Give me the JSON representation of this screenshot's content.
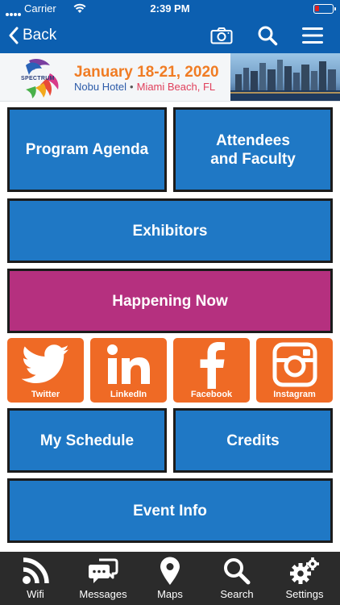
{
  "status": {
    "carrier": "Carrier",
    "time": "2:39 PM"
  },
  "nav": {
    "back_label": "Back"
  },
  "banner": {
    "logo_text": "SPECTRUM",
    "dates": "January 18-21, 2020",
    "venue": "Nobu Hotel",
    "separator": "•",
    "city": "Miami Beach, FL"
  },
  "tiles": {
    "program_agenda": "Program Agenda",
    "attendees_line1": "Attendees",
    "attendees_line2": "and Faculty",
    "exhibitors": "Exhibitors",
    "happening_now": "Happening Now",
    "my_schedule": "My Schedule",
    "credits": "Credits",
    "event_info": "Event Info"
  },
  "social": [
    {
      "label": "Twitter",
      "icon": "twitter-icon"
    },
    {
      "label": "LinkedIn",
      "icon": "linkedin-icon"
    },
    {
      "label": "Facebook",
      "icon": "facebook-icon"
    },
    {
      "label": "Instagram",
      "icon": "instagram-icon"
    }
  ],
  "tabs": [
    {
      "label": "Wifi",
      "icon": "wifi-icon"
    },
    {
      "label": "Messages",
      "icon": "messages-icon"
    },
    {
      "label": "Maps",
      "icon": "map-pin-icon"
    },
    {
      "label": "Search",
      "icon": "search-icon"
    },
    {
      "label": "Settings",
      "icon": "gears-icon"
    }
  ],
  "colors": {
    "header_blue": "#0c5fb0",
    "tile_blue": "#1f78c5",
    "magenta": "#b5307f",
    "social_orange": "#ef6a25",
    "tabbar": "#2b2b2b",
    "date_orange": "#f07c24"
  }
}
